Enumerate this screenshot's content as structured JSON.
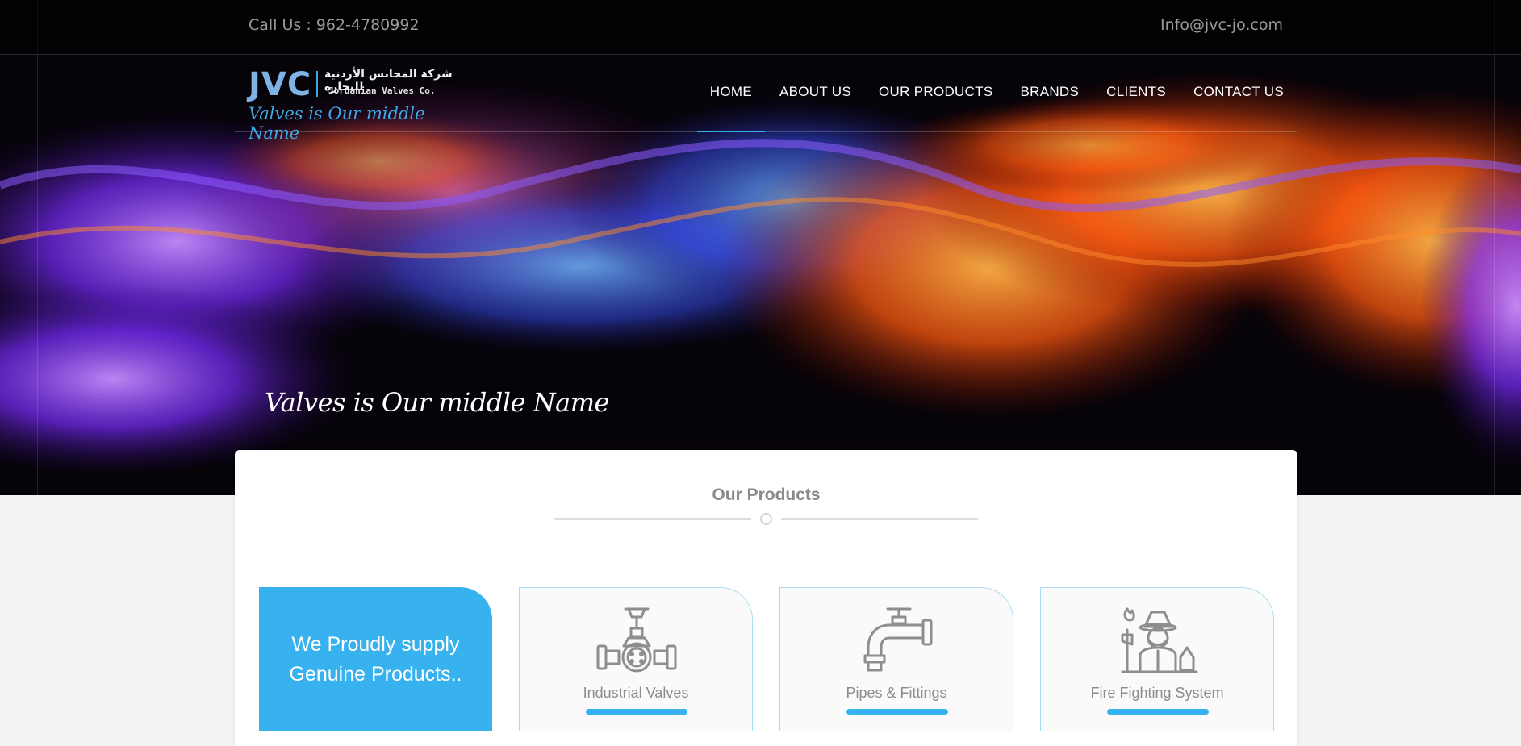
{
  "topbar": {
    "call": "Call Us : 962-4780992",
    "email": "Info@jvc-jo.com"
  },
  "logo": {
    "mark": "JVC",
    "arabic": "شركة المحابس الأردنية للتجارة",
    "english": "Jordanian Valves Co.",
    "tagline": "Valves is Our middle Name"
  },
  "nav": {
    "items": [
      {
        "label": "HOME",
        "active": true
      },
      {
        "label": "ABOUT US"
      },
      {
        "label": "OUR PRODUCTS"
      },
      {
        "label": "BRANDS"
      },
      {
        "label": "CLIENTS"
      },
      {
        "label": "CONTACT US"
      }
    ]
  },
  "hero": {
    "caption": "Valves is Our middle Name"
  },
  "products": {
    "title": "Our Products",
    "promo": "We Proudly supply Genuine Products..",
    "cards": [
      {
        "label": "Industrial Valves",
        "icon": "industrial-valve-icon"
      },
      {
        "label": "Pipes & Fittings",
        "icon": "pipe-faucet-icon"
      },
      {
        "label": "Fire Fighting System",
        "icon": "firefighter-icon"
      }
    ]
  },
  "colors": {
    "accent": "#37b2ee",
    "hero_bg": "#050208",
    "nav_text": "#ffffff",
    "muted_text": "#8c8c8c"
  }
}
